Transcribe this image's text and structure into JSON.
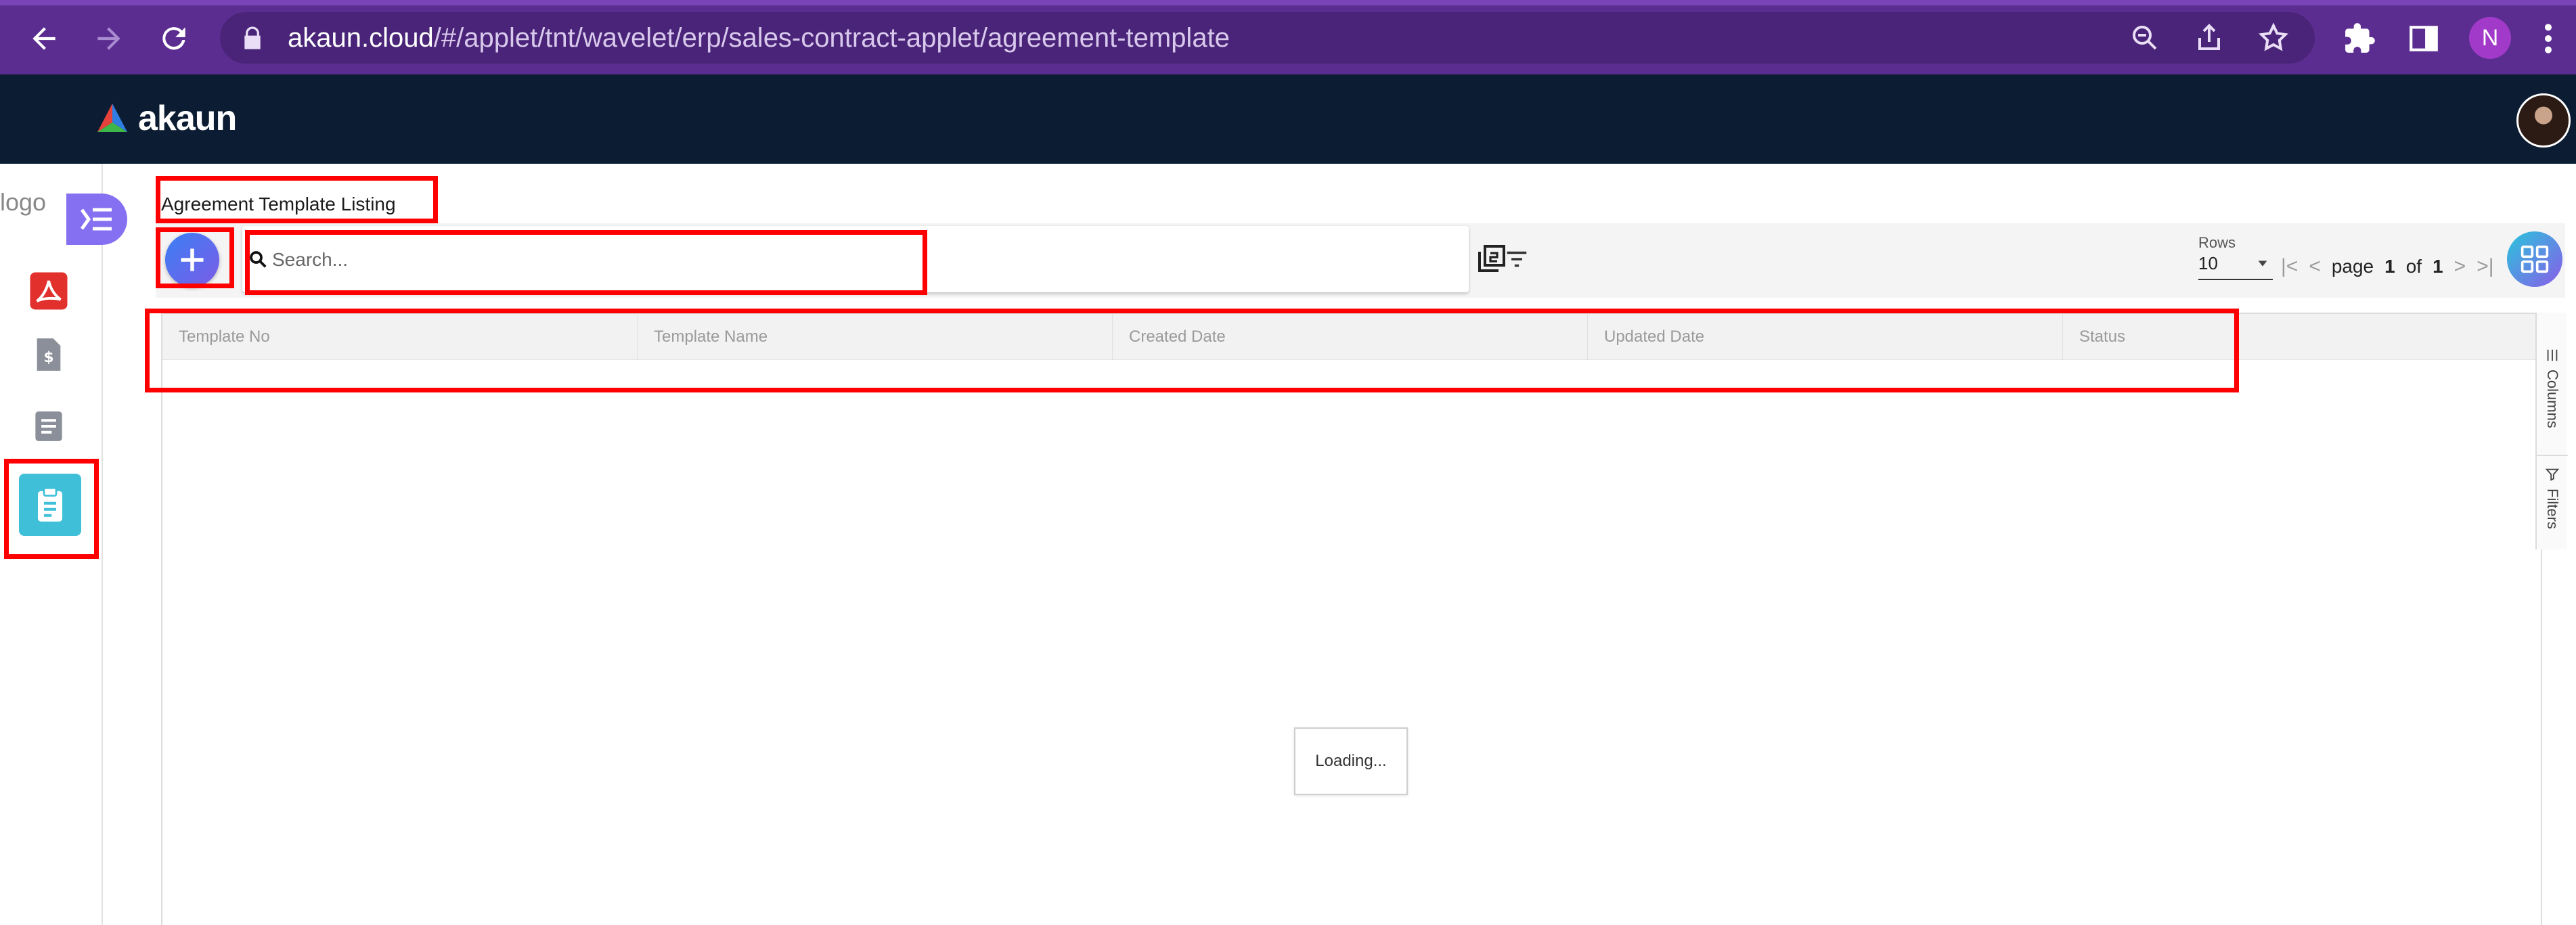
{
  "browser": {
    "url_host": "akaun.cloud",
    "url_path": "/#/applet/tnt/wavelet/erp/sales-contract-applet/agreement-template",
    "profile_initial": "N"
  },
  "app": {
    "brand": "akaun"
  },
  "sidebar": {
    "logo_alt": "logo",
    "items": [
      {
        "icon": "pdf-icon"
      },
      {
        "icon": "dollar-document-icon"
      },
      {
        "icon": "document-icon"
      },
      {
        "icon": "clipboard-icon",
        "active": true
      }
    ]
  },
  "page": {
    "title": "Agreement Template Listing"
  },
  "toolbar": {
    "search_placeholder": "Search...",
    "rows_label": "Rows",
    "rows_value": "10",
    "page_word": "page",
    "page_current": "1",
    "of_word": "of",
    "page_total": "1"
  },
  "table": {
    "columns": [
      "Template No",
      "Template Name",
      "Created Date",
      "Updated Date",
      "Status"
    ],
    "loading_text": "Loading..."
  },
  "side_panel": {
    "columns_label": "Columns",
    "filters_label": "Filters"
  },
  "colors": {
    "browser_chrome": "#5c2d91",
    "app_header": "#0c1d33",
    "active_item": "#3fc0d8",
    "annotation": "#ff0000"
  }
}
